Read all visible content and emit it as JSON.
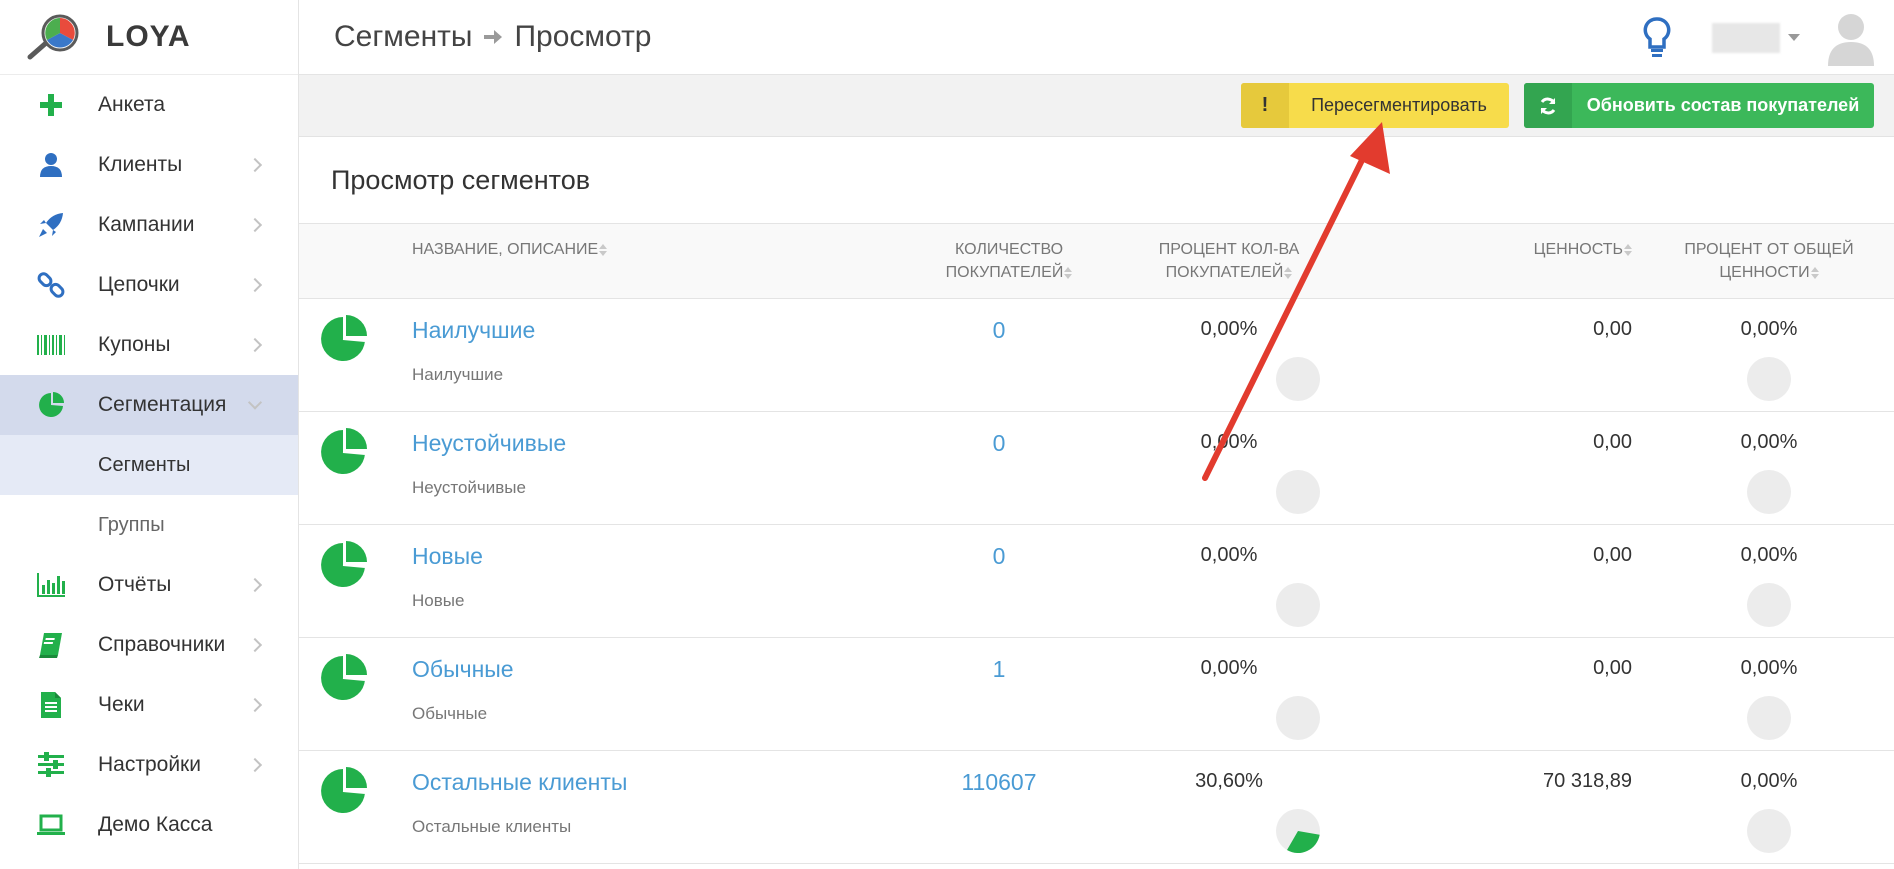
{
  "app": {
    "name": "LOYA"
  },
  "sidebar": {
    "items": [
      {
        "label": "Анкета",
        "icon": "plus-icon",
        "has_children": false
      },
      {
        "label": "Клиенты",
        "icon": "user-icon",
        "has_children": true
      },
      {
        "label": "Кампании",
        "icon": "rocket-icon",
        "has_children": true
      },
      {
        "label": "Цепочки",
        "icon": "chain-icon",
        "has_children": true
      },
      {
        "label": "Купоны",
        "icon": "barcode-icon",
        "has_children": true
      },
      {
        "label": "Сегментация",
        "icon": "pie-chart-icon",
        "has_children": true,
        "active": true,
        "children": [
          {
            "label": "Сегменты",
            "active": true
          },
          {
            "label": "Группы"
          }
        ]
      },
      {
        "label": "Отчёты",
        "icon": "bar-chart-icon",
        "has_children": true
      },
      {
        "label": "Справочники",
        "icon": "book-icon",
        "has_children": true
      },
      {
        "label": "Чеки",
        "icon": "receipt-icon",
        "has_children": true
      },
      {
        "label": "Настройки",
        "icon": "sliders-icon",
        "has_children": true
      },
      {
        "label": "Демо Касса",
        "icon": "laptop-icon",
        "has_children": false
      }
    ]
  },
  "header": {
    "breadcrumb": [
      "Сегменты",
      "Просмотр"
    ]
  },
  "toolbar": {
    "resegment_label": "Пересегментировать",
    "resegment_icon_text": "!",
    "update_label": "Обновить состав покупателей"
  },
  "main": {
    "title": "Просмотр сегментов",
    "columns": {
      "name": "НАЗВАНИЕ, ОПИСАНИЕ",
      "count_l1": "КОЛИЧЕСТВО",
      "count_l2": "ПОКУПАТЕЛЕЙ",
      "pct_l1": "ПРОЦЕНТ КОЛ-ВА",
      "pct_l2": "ПОКУПАТЕЛЕЙ",
      "value": "ЦЕННОСТЬ",
      "pct_value_l1": "ПРОЦЕНТ ОТ ОБЩЕЙ",
      "pct_value_l2": "ЦЕННОСТИ"
    },
    "rows": [
      {
        "name": "Наилучшие",
        "desc": "Наилучшие",
        "count": "0",
        "pct": "0,00%",
        "pct_fraction": 0,
        "value": "0,00",
        "value_pct": "0,00%",
        "value_fraction": 0
      },
      {
        "name": "Неустойчивые",
        "desc": "Неустойчивые",
        "count": "0",
        "pct": "0,00%",
        "pct_fraction": 0,
        "value": "0,00",
        "value_pct": "0,00%",
        "value_fraction": 0
      },
      {
        "name": "Новые",
        "desc": "Новые",
        "count": "0",
        "pct": "0,00%",
        "pct_fraction": 0,
        "value": "0,00",
        "value_pct": "0,00%",
        "value_fraction": 0
      },
      {
        "name": "Обычные",
        "desc": "Обычные",
        "count": "1",
        "pct": "0,00%",
        "pct_fraction": 0,
        "value": "0,00",
        "value_pct": "0,00%",
        "value_fraction": 0
      },
      {
        "name": "Остальные клиенты",
        "desc": "Остальные клиенты",
        "count": "110607",
        "pct": "30,60%",
        "pct_fraction": 0.306,
        "value": "70 318,89",
        "value_pct": "0,00%",
        "value_fraction": 0
      }
    ]
  },
  "colors": {
    "accent_green": "#22b04b",
    "link_blue": "#4a9bd4",
    "button_yellow": "#f7dc4b",
    "button_green": "#3cb85a",
    "annotation_red": "#e23b2e",
    "sidebar_active": "#d3daec"
  }
}
